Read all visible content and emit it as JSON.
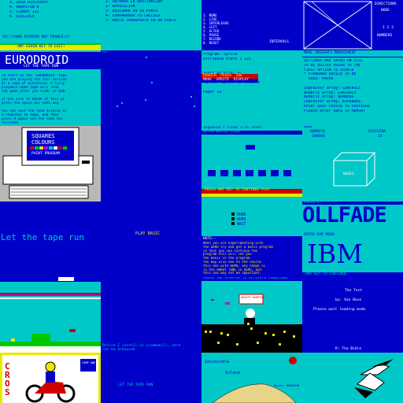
{
  "colors": {
    "blue": "#0000c8",
    "cyan": "#00c8c8",
    "white": "#ffffff",
    "yellow": "#e8e800",
    "red": "#d00000",
    "green": "#00c800",
    "magenta": "#c800c8",
    "grey": "#b8b8b8",
    "black": "#000000"
  },
  "r0": {
    "menu1": {
      "items": [
        "3. GRID DISCOVERY",
        "4. HAMPSTON D",
        "5. LIBERT III",
        "6. DISCIPLE"
      ],
      "info": "SEC:FOUND POINTER NOT FRANCE(S)",
      "prompt": "ANY GIVEN KEY TO EXIT!"
    },
    "menu2": {
      "items": [
        "1- OBTENER LA DESTINACION",
        "2- AMPEDICION",
        "3- DESCUBRA EN UN PUNTO",
        "4- COMPARANDO TU CALCULO",
        "5- ANOTA TRANSPORTE EN UN PUNTO"
      ]
    },
    "keys": {
      "items": [
        "1. NONE",
        "2. LIVE",
        "3. INTERLEAVE",
        "4. LEFT",
        "5. ALTER",
        "6. PAUSE",
        "7. RECORD",
        "8. RESET"
      ],
      "footer": "INTERVALS"
    },
    "wire": {
      "label1": "DIRECTIONS",
      "label2": "NODE",
      "label3": "1 2 3",
      "label4": "NUMBERS"
    }
  },
  "r1": {
    "euro": {
      "title": "EURODROID",
      "sub": "LET THE TAPE RUN",
      "lines": [
        "To start on the \"EURODROID\" tape",
        "you are playing the full version",
        "of a copy of Eurodroid. A fully",
        "playable demo tape will load",
        "the game after you START or RUN.",
        "",
        "If you wish to BREAK at this pt",
        "press the Space bar SAVE key.",
        "",
        "You can save the room display as",
        "a snapshot to tape, and then",
        "press M again and the code has",
        "finished."
      ]
    },
    "space": {
      "label": "P1"
    },
    "opts": {
      "lines": [
        "Program: Sprite",
        "Attribute state 3 115",
        "",
        "",
        "Start on grid: 42",
        "",
        "Current sprite is visible",
        "",
        "Paper 19"
      ],
      "red1": "BORDER  PAPER  INK",
      "red2": "MOVE  SPRITE  DISPLAY"
    },
    "mgmt": {
      "title": "MORE INSIGHTS MANAGEMENT -",
      "lines": [
        "SETTINGS ARE SAVED ON DISC",
        "TO BE EDITED PRIOR TO THE",
        "FIRST OPTION TO UPDATE",
        "* STANDARD DEVICE TO BE",
        "  USED: PAPER",
        "",
        "Character array: CONTROLS",
        "Numeric array: CONTROLS",
        "Numeric array: NUMBERS",
        "Character array: EXPENSES",
        "Enter your choice to continue",
        "Please enter data in MEMORY"
      ]
    }
  },
  "r2": {
    "computer": {
      "screen1": "SQUARES",
      "screen2": "COLOURS",
      "screen3": "PAINT PROGRAM"
    },
    "strip": {
      "header": "Sequence 1 lines 1-15 level",
      "header2": "Hello world: LIVE",
      "red": "PRESS ANY KEY TO CONTINUE PLAY"
    },
    "measure": {
      "label1": "NUMBERS",
      "val1": "100000",
      "label2": "DIVISION",
      "val2": "14",
      "top": "NODE",
      "box": "BOXES"
    }
  },
  "r3": {
    "tape": {
      "text": "Let the tape run"
    },
    "play": {
      "text": "PLAY BASIC"
    },
    "menu3": {
      "items": [
        "DONE",
        "WORK",
        "WAIT"
      ],
      "note_title": "NOTE:-",
      "note": [
        "When you are experimenting with",
        "the DEMO try and get a basic program",
        "so that you can continue the",
        "program this will let you",
        "the Basic in the program.",
        "You may also see to the source",
        "this one with DEMO, any shown is",
        "in the ARRAY TUNE in DEMO, and",
        "this one may not be important."
      ]
    },
    "logos": {
      "caption1": "PRESS Fl",
      "title1": "OLLFADE",
      "caption2": "ENTER OUR MENU",
      "title2": "IBM",
      "bottom": "ANY KEY TO CONTINUE"
    }
  },
  "r4": {
    "game": {},
    "blank": {
      "lines": [
        "Before I install:in cinemakill, here",
        "can be enhanced"
      ]
    },
    "city": {
      "header": "PRESS THE STRETCH TO ACTIVATE FURNITURE",
      "sign": "GHOSTS HUNTING"
    },
    "intro": {
      "line1": "The Test",
      "line2": "by: Van Bove",
      "line3": "Please wait loading mode",
      "footer": "R: The Bible"
    }
  },
  "r5": {
    "cross": {
      "title": "CROS",
      "badge": "COMP ONE"
    },
    "blank2": {
      "text": "LET THE TAPE RUN"
    },
    "island": {
      "line1": "Invincible",
      "line2": "Island",
      "corner": "Money: 0000000"
    },
    "bird": {}
  }
}
